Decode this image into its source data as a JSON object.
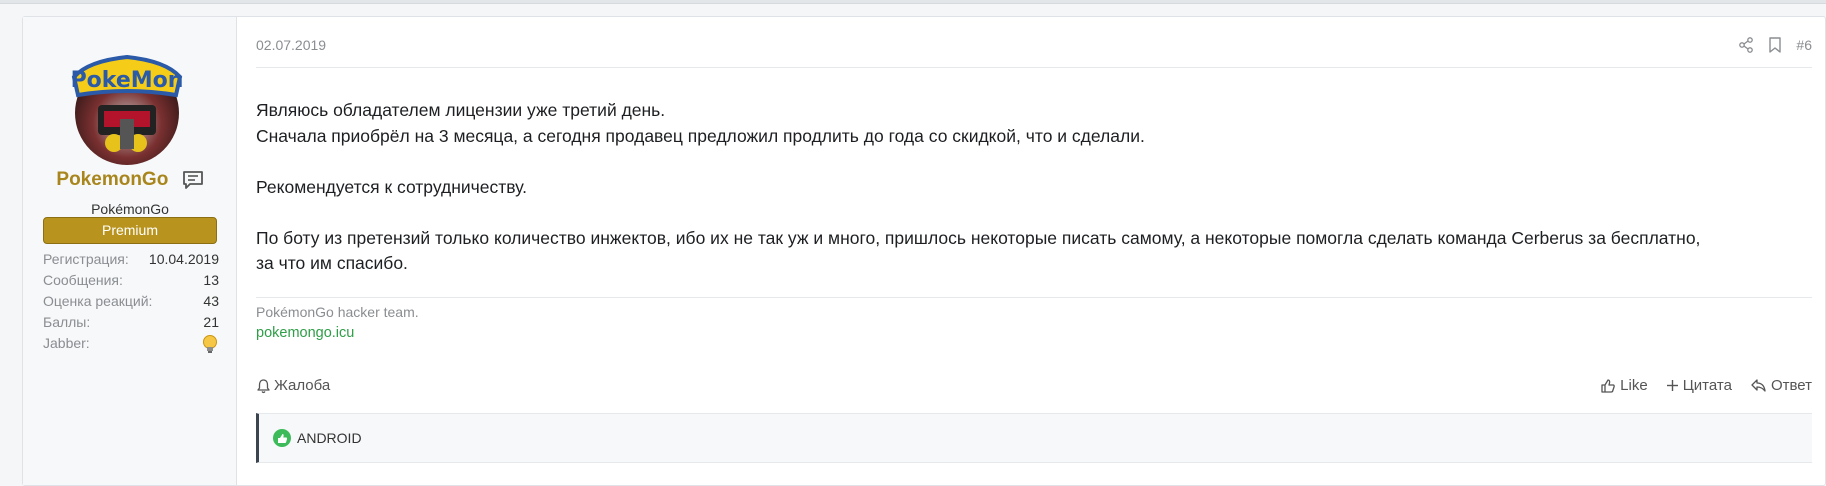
{
  "post": {
    "date": "02.07.2019",
    "number": "#6",
    "body": {
      "line1": "Являюсь обладателем лицензии уже третий день.",
      "line2": "Сначала приобрёл на 3 месяца, а сегодня продавец предложил продлить до года со скидкой, что и сделали.",
      "line3": "Рекомендуется к сотрудничеству.",
      "line4": "По боту из претензий только количество инжектов, ибо их не так уж и много, пришлось некоторые писать самому, а некоторые помогла сделать команда Cerberus за бесплатно,",
      "line5": "за что им спасибо."
    },
    "signature": {
      "text": "PokémonGo hacker team.",
      "link": "pokemongo.icu"
    },
    "actions": {
      "report": "Жалоба",
      "like": "Like",
      "quote": "Цитата",
      "reply": "Ответ"
    },
    "reactions": {
      "label": "ANDROID"
    }
  },
  "user": {
    "name": "PokemonGo",
    "title": "PokémonGo",
    "banner": "Premium",
    "stats": [
      {
        "label": "Регистрация:",
        "value": "10.04.2019"
      },
      {
        "label": "Сообщения:",
        "value": "13"
      },
      {
        "label": "Оценка реакций:",
        "value": "43"
      },
      {
        "label": "Баллы:",
        "value": "21"
      },
      {
        "label": "Jabber:",
        "value": ""
      }
    ]
  },
  "colors": {
    "username": "#a8861d",
    "banner": "#b8941f",
    "link": "#2e9e47",
    "like_badge": "#3dbb5a"
  },
  "icons": [
    "chat-bubble-icon",
    "lightbulb-icon",
    "share-icon",
    "bookmark-icon",
    "bell-icon",
    "thumbs-up-icon",
    "plus-icon",
    "reply-icon"
  ]
}
